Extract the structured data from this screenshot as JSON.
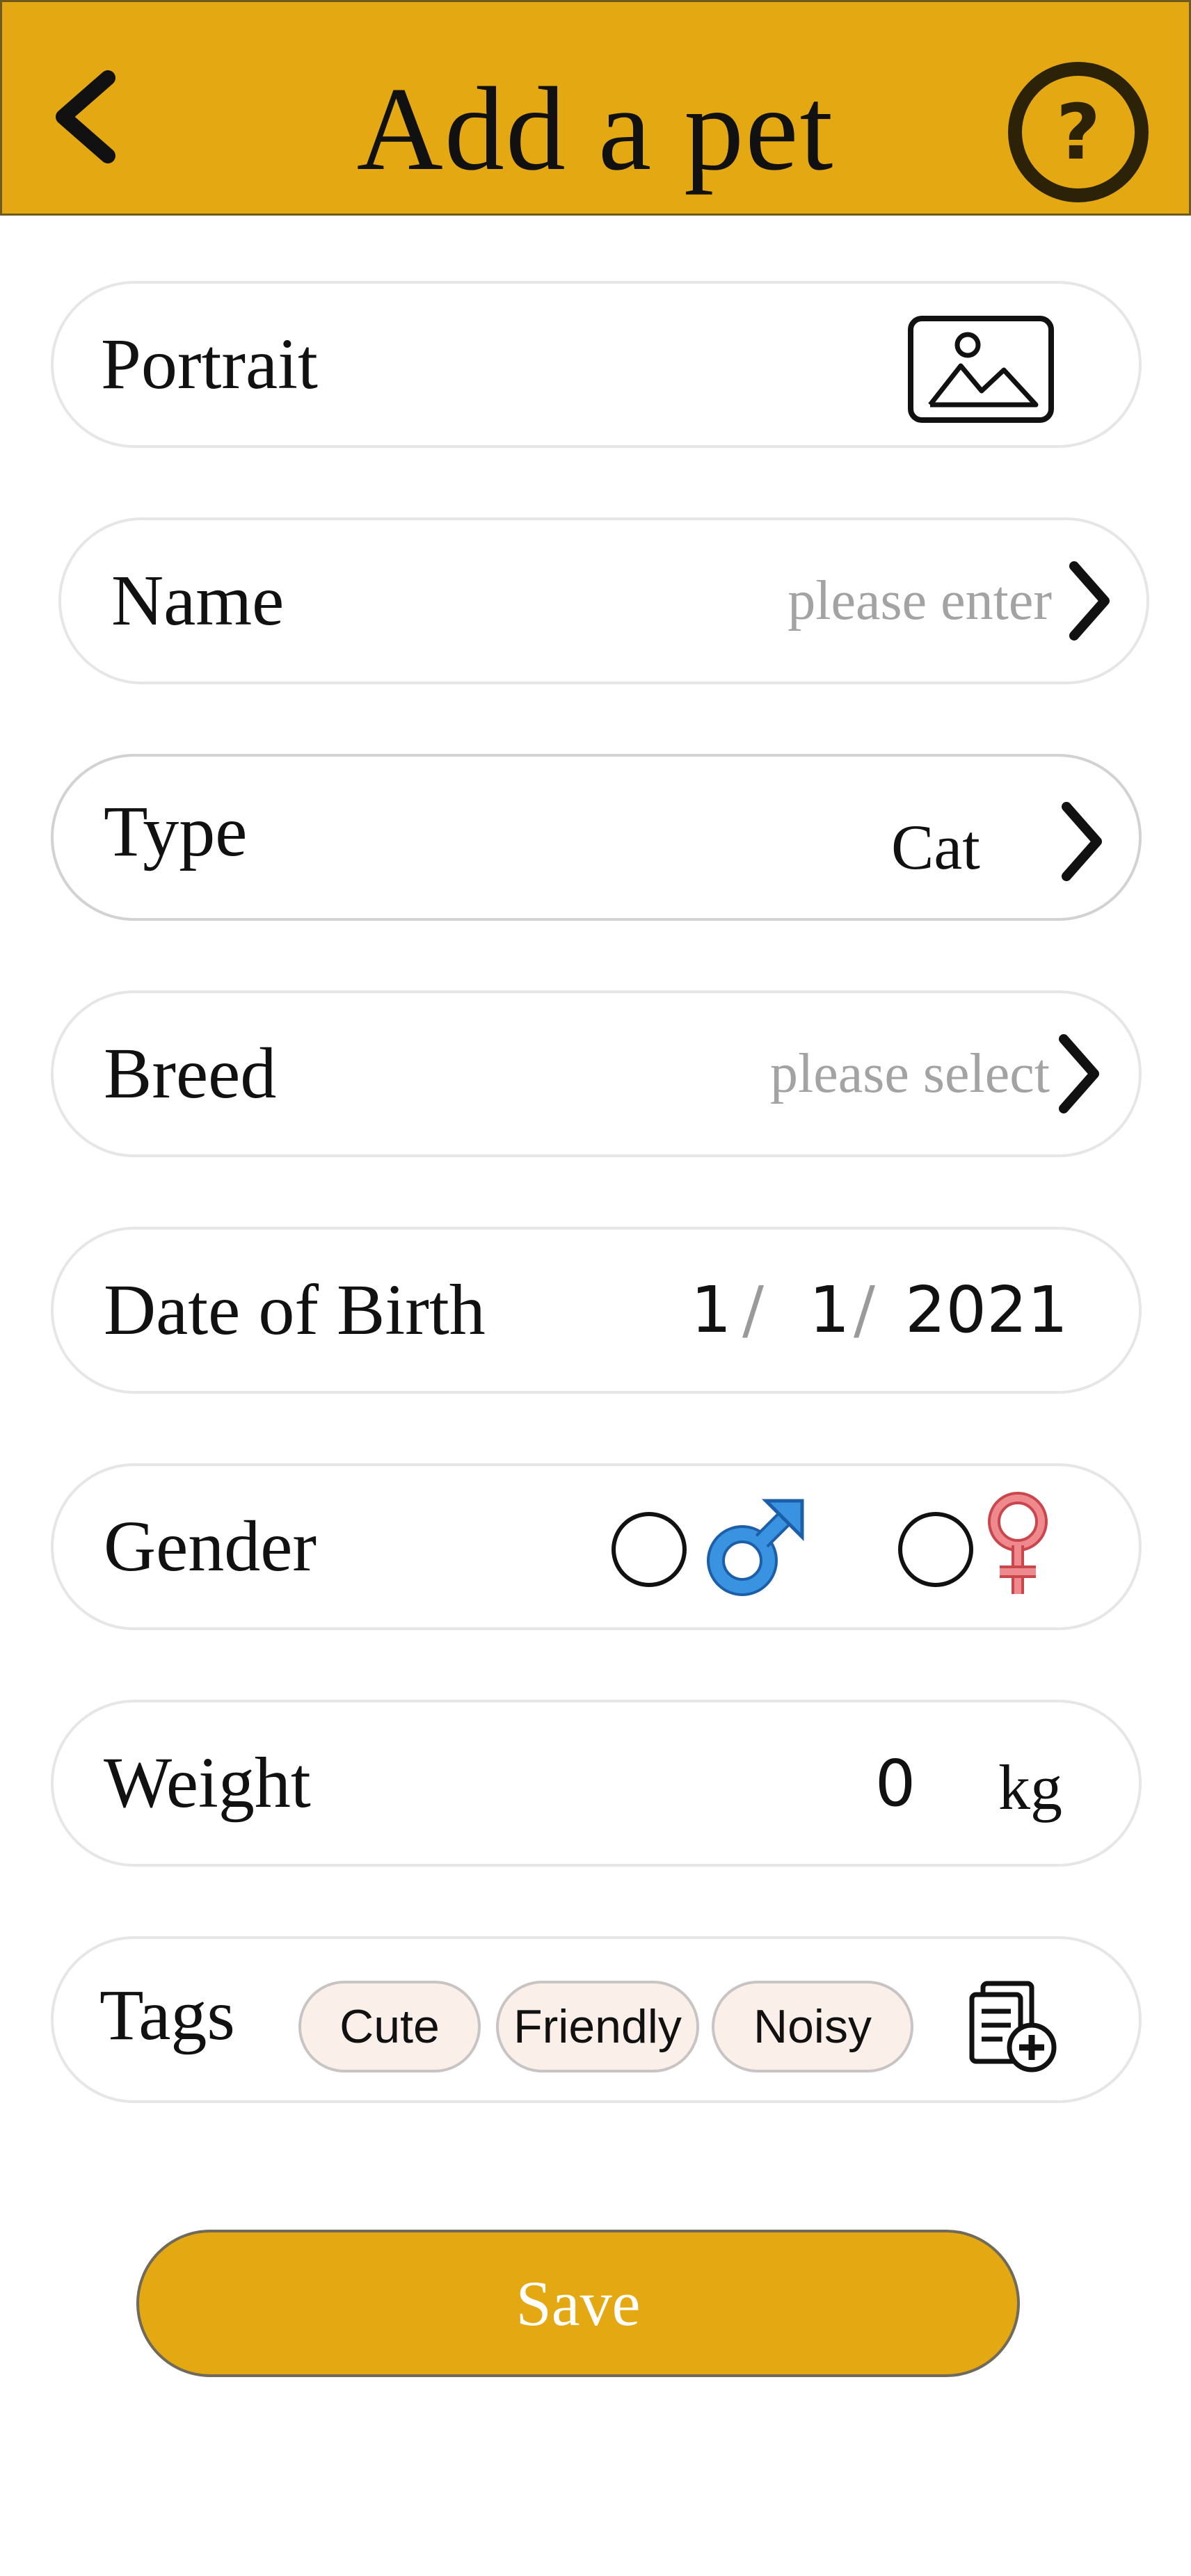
{
  "header": {
    "title": "Add a pet",
    "back_icon": "chevron-left-icon",
    "help_icon": "help-circle-icon",
    "help_glyph": "?",
    "background_color": "#E4A912"
  },
  "form": {
    "portrait": {
      "label": "Portrait",
      "icon": "image-icon"
    },
    "name": {
      "label": "Name",
      "placeholder": "please enter"
    },
    "type": {
      "label": "Type",
      "value": "Cat"
    },
    "breed": {
      "label": "Breed",
      "placeholder": "please select"
    },
    "dob": {
      "label": "Date of Birth",
      "month": "1",
      "day": "1",
      "year": "2021",
      "separator": "/"
    },
    "gender": {
      "label": "Gender",
      "male_icon": "male-symbol-icon",
      "female_icon": "female-symbol-icon",
      "male_color": "#2f86d6",
      "female_color": "#e8787c",
      "selected": "none"
    },
    "weight": {
      "label": "Weight",
      "value": "0",
      "unit": "kg"
    },
    "tags": {
      "label": "Tags",
      "items": [
        "Cute",
        "Friendly",
        "Noisy"
      ],
      "add_icon": "add-tag-icon"
    }
  },
  "actions": {
    "save_label": "Save",
    "accent_color": "#E4A912"
  }
}
